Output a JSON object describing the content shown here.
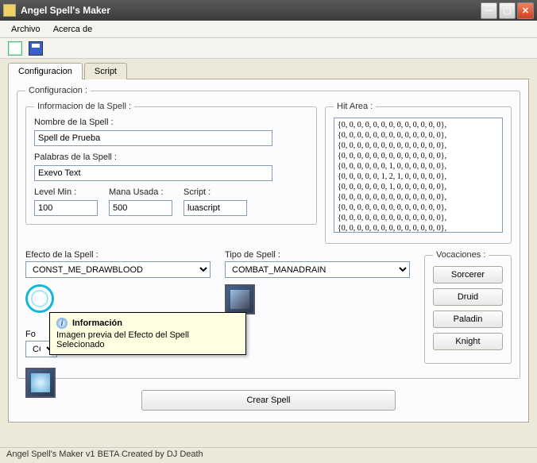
{
  "window": {
    "title": "Angel Spell's Maker"
  },
  "menu": {
    "archivo": "Archivo",
    "acerca": "Acerca de"
  },
  "tabs": {
    "config": "Configuracion",
    "script": "Script"
  },
  "config_legend": "Configuracion :",
  "info": {
    "legend": "Informacion de la Spell :",
    "name_label": "Nombre de la Spell :",
    "name_value": "Spell de Prueba",
    "words_label": "Palabras de la Spell :",
    "words_value": "Exevo Text",
    "level_label": "Level Min :",
    "level_value": "100",
    "mana_label": "Mana Usada :",
    "mana_value": "500",
    "script_label": "Script :",
    "script_value": "luascript"
  },
  "hit": {
    "legend": "Hit Area :",
    "text": "{0, 0, 0, 0, 0, 0, 0, 0, 0, 0, 0, 0, 0},\n{0, 0, 0, 0, 0, 0, 0, 0, 0, 0, 0, 0, 0},\n{0, 0, 0, 0, 0, 0, 0, 0, 0, 0, 0, 0, 0},\n{0, 0, 0, 0, 0, 0, 0, 0, 0, 0, 0, 0, 0},\n{0, 0, 0, 0, 0, 0, 1, 0, 0, 0, 0, 0, 0},\n{0, 0, 0, 0, 0, 1, 2, 1, 0, 0, 0, 0, 0},\n{0, 0, 0, 0, 0, 0, 1, 0, 0, 0, 0, 0, 0},\n{0, 0, 0, 0, 0, 0, 0, 0, 0, 0, 0, 0, 0},\n{0, 0, 0, 0, 0, 0, 0, 0, 0, 0, 0, 0, 0},\n{0, 0, 0, 0, 0, 0, 0, 0, 0, 0, 0, 0, 0},\n{0, 0, 0, 0, 0, 0, 0, 0, 0, 0, 0, 0, 0},"
  },
  "effect": {
    "label": "Efecto de la Spell :",
    "value": "CONST_ME_DRAWBLOOD"
  },
  "spelltype": {
    "label": "Tipo de Spell :",
    "value": "COMBAT_MANADRAIN"
  },
  "formula": {
    "label_short": "Fo",
    "value_short": "COM"
  },
  "vocations": {
    "legend": "Vocaciones :",
    "sorcerer": "Sorcerer",
    "druid": "Druid",
    "paladin": "Paladin",
    "knight": "Knight"
  },
  "tooltip": {
    "title": "Información",
    "body": "Imagen previa del Efecto del Spell Selecionado"
  },
  "crear": "Crear Spell",
  "status": "Angel Spell's Maker v1 BETA Created by DJ Death"
}
